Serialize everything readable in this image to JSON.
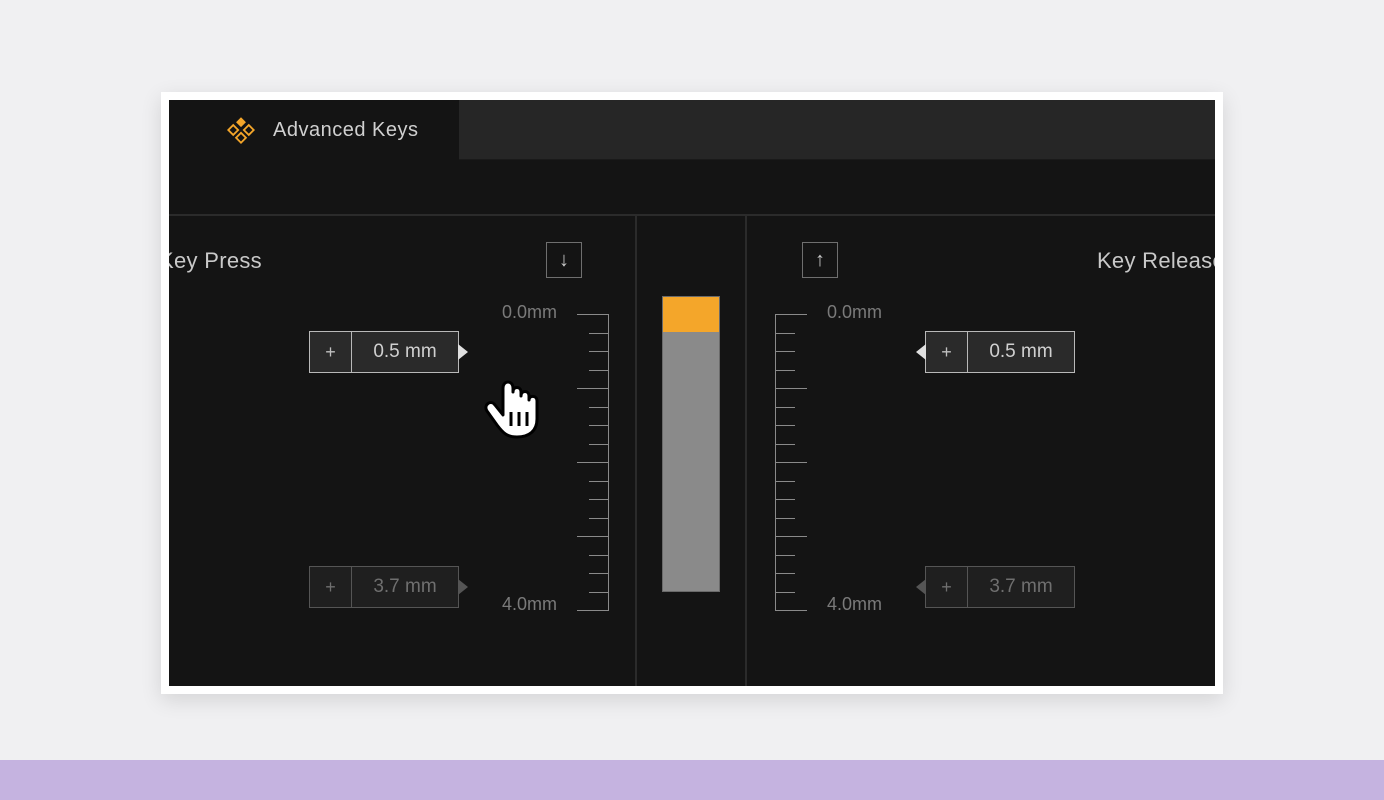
{
  "colors": {
    "accent": "#f4a62a"
  },
  "tab": {
    "label": "Advanced Keys"
  },
  "left": {
    "title": "Key Press",
    "arrow": "↓",
    "ruler_top": "0.0mm",
    "ruler_bot": "4.0mm",
    "marker_upper": {
      "plus": "+",
      "value": "0.5 mm"
    },
    "marker_lower": {
      "plus": "+",
      "value": "3.7 mm"
    }
  },
  "right": {
    "title": "Key Release",
    "arrow": "↑",
    "ruler_top": "0.0mm",
    "ruler_bot": "4.0mm",
    "marker_upper": {
      "plus": "+",
      "value": "0.5 mm"
    },
    "marker_lower": {
      "plus": "+",
      "value": "3.7 mm"
    }
  },
  "meter": {
    "grey_top_pct": 12,
    "orange_height_pct": 12
  }
}
